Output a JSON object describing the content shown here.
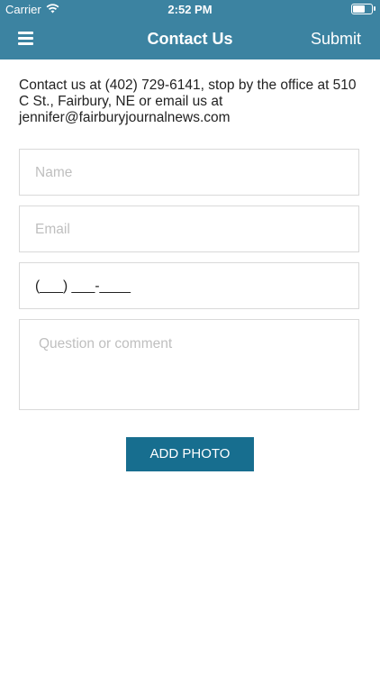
{
  "status_bar": {
    "carrier": "Carrier",
    "time": "2:52 PM",
    "wifi_icon": "wifi-icon",
    "battery_icon": "battery-icon"
  },
  "nav": {
    "menu_icon": "hamburger-menu-icon",
    "title": "Contact Us",
    "submit_label": "Submit"
  },
  "intro": {
    "text": "Contact us at (402) 729-6141, stop by the office at 510 C St., Fairbury, NE or email us at jennifer@fairburyjournalnews.com"
  },
  "form": {
    "name_placeholder": "Name",
    "email_placeholder": "Email",
    "phone_value": "(___) ___-____",
    "comment_placeholder": "Question or comment",
    "add_photo_label": "ADD PHOTO"
  },
  "colors": {
    "header": "#3c83a1",
    "button": "#176e8f"
  }
}
